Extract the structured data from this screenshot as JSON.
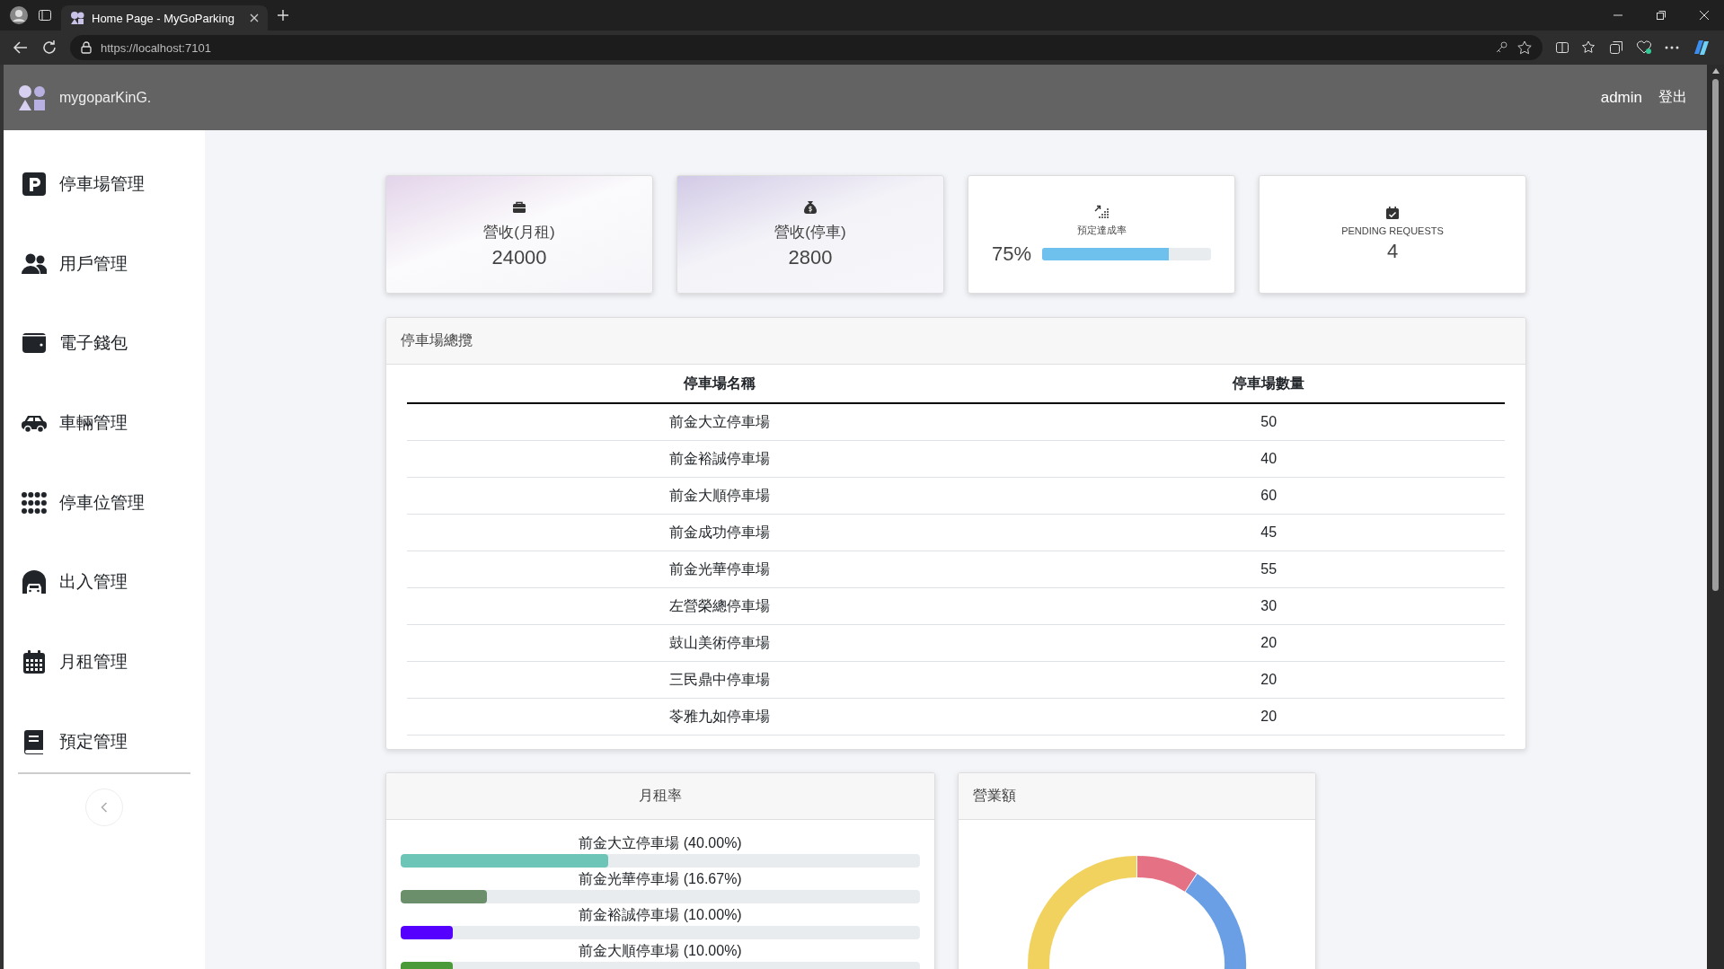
{
  "browser": {
    "tab_title": "Home Page - MyGoParking",
    "url": "https://localhost:7101"
  },
  "header": {
    "brand": "mygoparKinG.",
    "user": "admin",
    "logout": "登出"
  },
  "sidebar": {
    "items": [
      {
        "label": "停車場管理"
      },
      {
        "label": "用戶管理"
      },
      {
        "label": "電子錢包"
      },
      {
        "label": "車輛管理"
      },
      {
        "label": "停車位管理"
      },
      {
        "label": "出入管理"
      },
      {
        "label": "月租管理"
      },
      {
        "label": "預定管理"
      }
    ]
  },
  "cards": [
    {
      "kind": "stat",
      "label": "營收(月租)",
      "value": "24000"
    },
    {
      "kind": "stat",
      "label": "營收(停車)",
      "value": "2800"
    },
    {
      "kind": "progress",
      "label": "預定達成率",
      "value": "75%",
      "level": 0.75
    },
    {
      "kind": "counter",
      "label": "PENDING REQUESTS",
      "value": "4"
    }
  ],
  "overview": {
    "title": "停車場總攬",
    "columns": [
      "停車場名稱",
      "停車場數量"
    ],
    "rows": [
      [
        "前金大立停車場",
        "50"
      ],
      [
        "前金裕誠停車場",
        "40"
      ],
      [
        "前金大順停車場",
        "60"
      ],
      [
        "前金成功停車場",
        "45"
      ],
      [
        "前金光華停車場",
        "55"
      ],
      [
        "左營榮總停車場",
        "30"
      ],
      [
        "鼓山美術停車場",
        "20"
      ],
      [
        "三民鼎中停車場",
        "20"
      ],
      [
        "苓雅九如停車場",
        "20"
      ]
    ]
  },
  "rent": {
    "title": "月租率",
    "items": [
      {
        "label": "前金大立停車場 (40.00%)",
        "level": 0.4,
        "color": "#6cc5b6"
      },
      {
        "label": "前金光華停車場 (16.67%)",
        "level": 0.1667,
        "color": "#6b8e6b"
      },
      {
        "label": "前金裕誠停車場 (10.00%)",
        "level": 0.1,
        "color": "#5500ff"
      },
      {
        "label": "前金大順停車場 (10.00%)",
        "level": 0.1,
        "color": "#4a9a3a"
      }
    ]
  },
  "revenue": {
    "title": "營業額"
  }
}
